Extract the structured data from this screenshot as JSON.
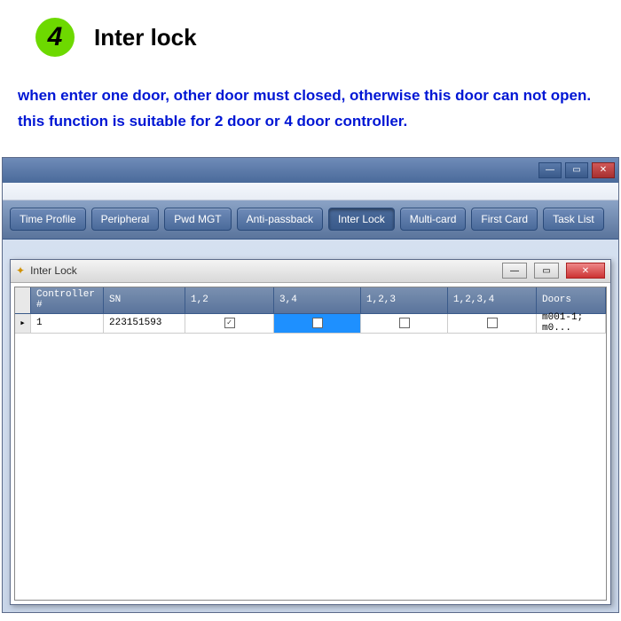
{
  "step": {
    "number": "4",
    "title": "Inter lock"
  },
  "description": "when enter one door, other door must closed, otherwise this door can not open.  this function is suitable for 2 door or 4 door controller.",
  "toolbar": {
    "buttons": [
      "Time Profile",
      "Peripheral",
      "Pwd MGT",
      "Anti-passback",
      "Inter Lock",
      "Multi-card",
      "First Card",
      "Task List"
    ],
    "active_index": 4
  },
  "child_window": {
    "title": "Inter Lock"
  },
  "grid": {
    "headers": [
      "Controller #",
      "SN",
      "1,2",
      "3,4",
      "1,2,3",
      "1,2,3,4",
      "Doors"
    ],
    "row": {
      "controller": "1",
      "sn": "223151593",
      "c12_checked": true,
      "c34_selected": true,
      "c34_checked": false,
      "c123_checked": false,
      "c1234_checked": false,
      "doors": "m001-1;  m0..."
    }
  },
  "chart_data": {
    "type": "table",
    "title": "Inter Lock",
    "columns": [
      "Controller #",
      "SN",
      "1,2",
      "3,4",
      "1,2,3",
      "1,2,3,4",
      "Doors"
    ],
    "rows": [
      {
        "Controller #": 1,
        "SN": "223151593",
        "1,2": true,
        "3,4": false,
        "1,2,3": false,
        "1,2,3,4": false,
        "Doors": "m001-1;  m0..."
      }
    ]
  }
}
